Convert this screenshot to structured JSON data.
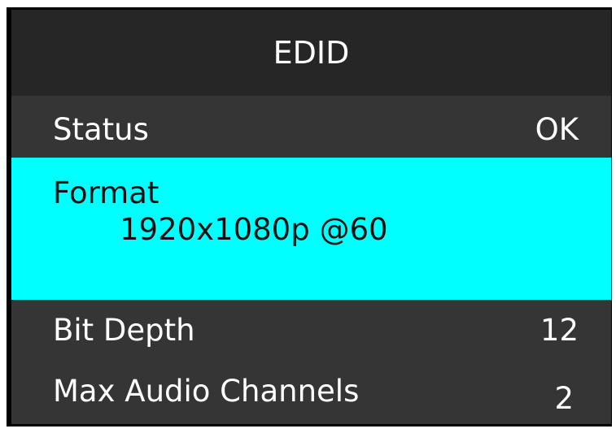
{
  "header": {
    "title": "EDID"
  },
  "rows": {
    "status": {
      "label": "Status",
      "value": "OK"
    },
    "format": {
      "label": "Format",
      "value": "1920x1080p @60"
    },
    "bit_depth": {
      "label": "Bit Depth",
      "value": "12"
    },
    "max_audio_channels": {
      "label": "Max Audio Channels",
      "value": "2"
    }
  },
  "colors": {
    "header_bg": "#262626",
    "row_bg": "#353535",
    "selected_bg": "#00ffff",
    "text": "#ffffff",
    "selected_text": "#111111"
  }
}
